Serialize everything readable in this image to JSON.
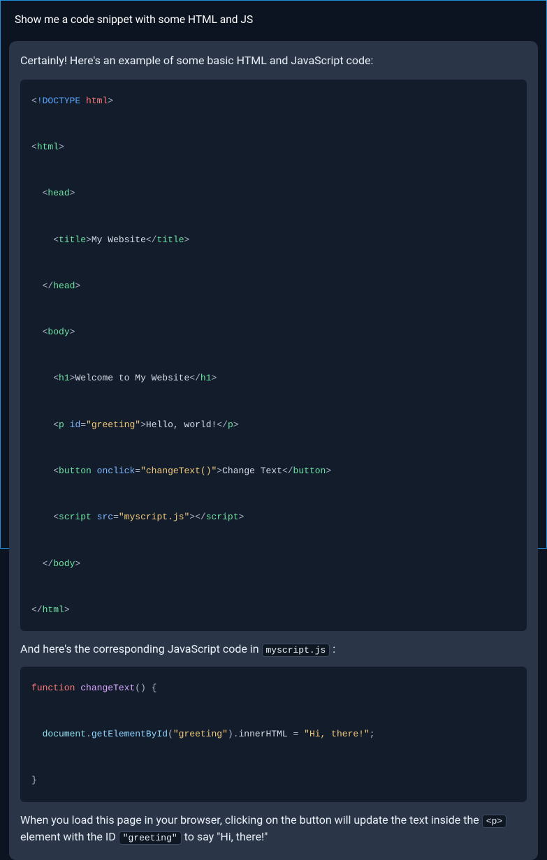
{
  "user_prompt": "Show me a code snippet with some HTML and JS",
  "response": {
    "intro": "Certainly! Here's an example of some basic HTML and JavaScript code:",
    "mid_text_prefix": "And here's the corresponding JavaScript code in ",
    "mid_text_code": "myscript.js",
    "mid_text_suffix": " :",
    "outro_prefix": "When you load this page in your browser, clicking on the button will update the text inside the ",
    "outro_code1": "<p>",
    "outro_mid": " element with the ID ",
    "outro_code2": "\"greeting\"",
    "outro_suffix": " to say \"Hi, there!\""
  },
  "code_html": {
    "doctype": "!DOCTYPE",
    "doctype_html": "html",
    "tag_html": "html",
    "tag_head": "head",
    "tag_title": "title",
    "title_text": "My Website",
    "tag_body": "body",
    "tag_h1": "h1",
    "h1_text": "Welcome to My Website",
    "tag_p": "p",
    "attr_id": "id",
    "id_val": "\"greeting\"",
    "p_text": "Hello, world!",
    "tag_button": "button",
    "attr_onclick": "onclick",
    "onclick_val": "\"changeText()\"",
    "button_text": "Change Text",
    "tag_script": "script",
    "attr_src": "src",
    "src_val": "\"myscript.js\""
  },
  "code_js": {
    "kw_function": "function",
    "fn_name": "changeText",
    "obj": "document",
    "method": "getElementById",
    "arg": "\"greeting\"",
    "prop": "innerHTML",
    "val": "\"Hi, there!\""
  }
}
